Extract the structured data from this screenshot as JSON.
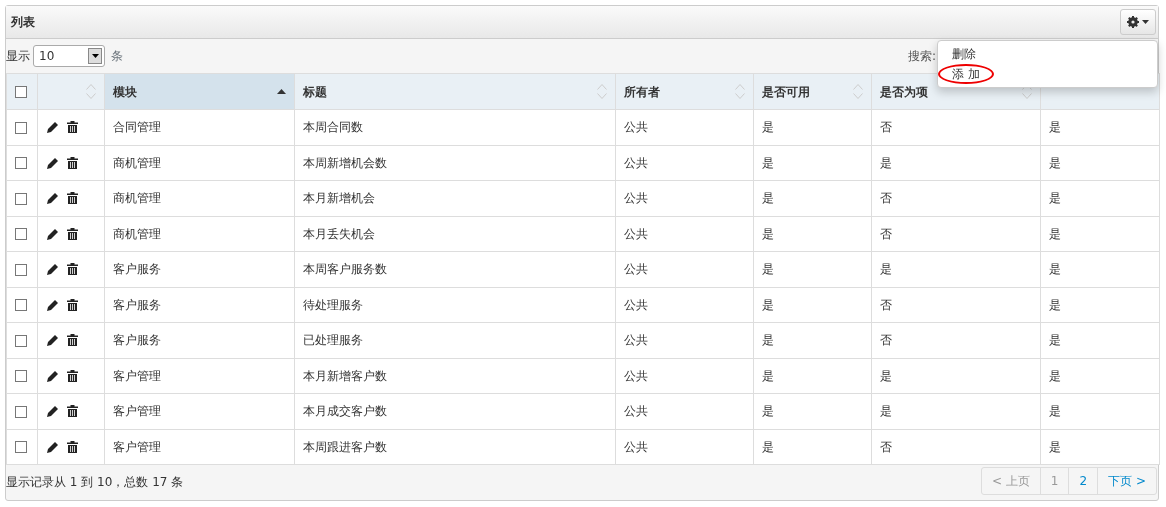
{
  "panel": {
    "title": "列表"
  },
  "length_control": {
    "prefix": "显示",
    "value": "10",
    "suffix": "条"
  },
  "search": {
    "label": "搜索:"
  },
  "menu": {
    "expanded": true,
    "items": [
      {
        "label": "删除",
        "highlighted": false
      },
      {
        "label": "添 加",
        "highlighted": true
      }
    ]
  },
  "table": {
    "select_all": {
      "checked": false
    },
    "actions_header": {
      "sorted": false
    },
    "columns": [
      {
        "kind": "text",
        "label": "模块",
        "sorted": true
      },
      {
        "kind": "text",
        "label": "标题",
        "sorted": false
      },
      {
        "kind": "text",
        "label": "所有者",
        "sorted": false
      },
      {
        "kind": "text",
        "label": "是否可用",
        "sorted": false
      },
      {
        "kind": "text",
        "label": "是否为项",
        "sorted": false
      },
      {
        "kind": "blank",
        "sorted": false
      }
    ],
    "rows": [
      {
        "checked": false,
        "cells": [
          "合同管理",
          "本周合同数",
          "公共",
          "是",
          "否",
          "是"
        ]
      },
      {
        "checked": false,
        "cells": [
          "商机管理",
          "本周新增机会数",
          "公共",
          "是",
          "是",
          "是"
        ]
      },
      {
        "checked": false,
        "cells": [
          "商机管理",
          "本月新增机会",
          "公共",
          "是",
          "否",
          "是"
        ]
      },
      {
        "checked": false,
        "cells": [
          "商机管理",
          "本月丢失机会",
          "公共",
          "是",
          "否",
          "是"
        ]
      },
      {
        "checked": false,
        "cells": [
          "客户服务",
          "本周客户服务数",
          "公共",
          "是",
          "是",
          "是"
        ]
      },
      {
        "checked": false,
        "cells": [
          "客户服务",
          "待处理服务",
          "公共",
          "是",
          "否",
          "是"
        ]
      },
      {
        "checked": false,
        "cells": [
          "客户服务",
          "已处理服务",
          "公共",
          "是",
          "否",
          "是"
        ]
      },
      {
        "checked": false,
        "cells": [
          "客户管理",
          "本月新增客户数",
          "公共",
          "是",
          "是",
          "是"
        ]
      },
      {
        "checked": false,
        "cells": [
          "客户管理",
          "本月成交客户数",
          "公共",
          "是",
          "是",
          "是"
        ]
      },
      {
        "checked": false,
        "cells": [
          "客户管理",
          "本周跟进客户数",
          "公共",
          "是",
          "否",
          "是"
        ]
      }
    ]
  },
  "footer": {
    "info": "显示记录从 1 到 10，总数 17 条",
    "pages": [
      {
        "label": "< 上页",
        "disabled": true
      },
      {
        "label": "1",
        "disabled": true
      },
      {
        "label": "2",
        "disabled": false
      },
      {
        "label": "下页 >",
        "disabled": false
      }
    ]
  }
}
